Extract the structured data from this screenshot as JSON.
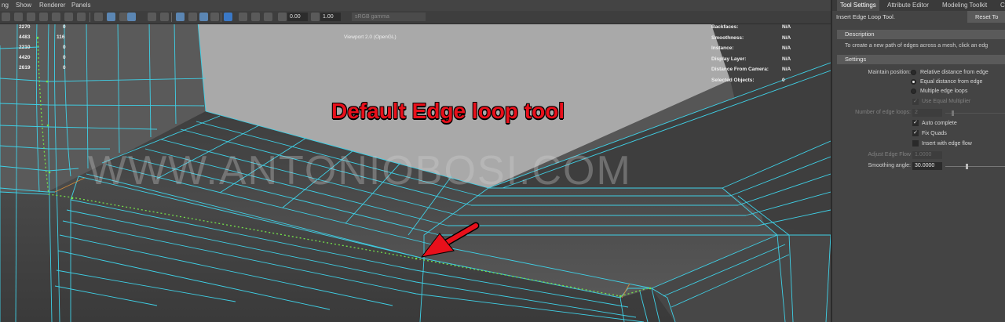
{
  "menu": {
    "items": [
      "ng",
      "Show",
      "Renderer",
      "Panels"
    ]
  },
  "toolbar": {
    "field1": "0.00",
    "field2": "1.00",
    "color_space": "sRGB gamma"
  },
  "hud": {
    "poly_counts": [
      {
        "a": "2270",
        "b": "0"
      },
      {
        "a": "4483",
        "b": "116"
      },
      {
        "a": "2210",
        "b": "0"
      },
      {
        "a": "4420",
        "b": "0"
      },
      {
        "a": "2619",
        "b": "0"
      }
    ],
    "viewport_label": "Viewport 2.0 (OpenGL)",
    "stats": [
      {
        "label": "Backfaces:",
        "value": "N/A"
      },
      {
        "label": "Smoothness:",
        "value": "N/A"
      },
      {
        "label": "Instance:",
        "value": "N/A"
      },
      {
        "label": "Display Layer:",
        "value": "N/A"
      },
      {
        "label": "Distance From Camera:",
        "value": "N/A"
      },
      {
        "label": "Selected Objects:",
        "value": "0"
      }
    ]
  },
  "annotation": {
    "title": "Default Edge loop tool",
    "watermark": "WWW.ANTONIOBOSI.COM",
    "arrow_color": "#e8101b"
  },
  "panel": {
    "tabs": [
      "Tool Settings",
      "Attribute Editor",
      "Modeling Toolkit",
      "C"
    ],
    "tool_name": "Insert Edge Loop Tool.",
    "reset_label": "Reset To",
    "description_header": "Description",
    "description_text": "To create a new path of edges across a mesh, click an edg",
    "settings_header": "Settings",
    "maintain_label": "Maintain position:",
    "maintain_options": [
      {
        "label": "Relative distance from edge",
        "selected": false
      },
      {
        "label": "Equal distance from edge",
        "selected": true
      },
      {
        "label": "Multiple edge loops",
        "selected": false
      }
    ],
    "use_equal_multiplier": "Use Equal Multiplier",
    "num_loops_label": "Number of edge loops:",
    "num_loops_value": "2",
    "auto_complete": "Auto complete",
    "fix_quads": "Fix Quads",
    "insert_edge_flow": "Insert with edge flow",
    "adjust_flow_label": "Adjust Edge Flow",
    "adjust_flow_value": "1.0000",
    "smoothing_label": "Smoothing angle:",
    "smoothing_value": "30.0000"
  },
  "colors": {
    "wire": "#3fd0e6",
    "selected_edge": "#74e04a",
    "accent": "#e8101b"
  }
}
